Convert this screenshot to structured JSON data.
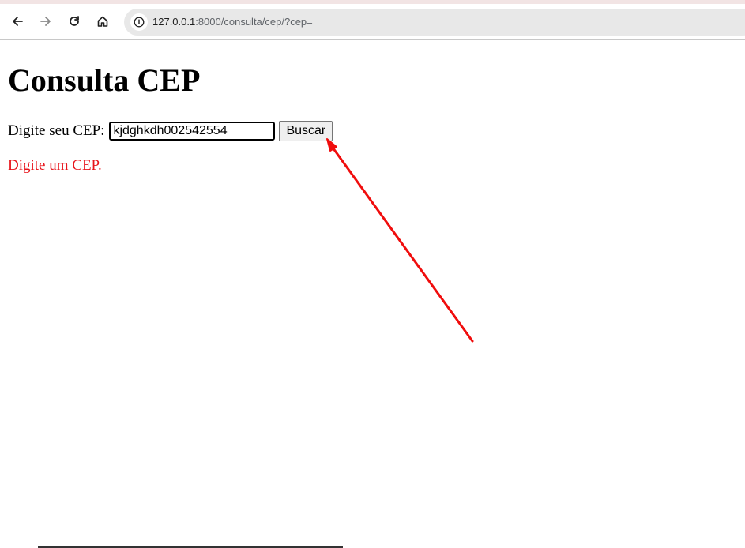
{
  "browser": {
    "url_host": "127.0.0.1",
    "url_rest": ":8000/consulta/cep/?cep=",
    "icons": [
      "back-arrow-icon",
      "forward-arrow-icon",
      "reload-icon",
      "home-icon",
      "site-info-icon"
    ]
  },
  "page": {
    "title": "Consulta CEP",
    "form": {
      "label": "Digite seu CEP:",
      "input_value": "kjdghkdh002542554",
      "button_label": "Buscar"
    },
    "error_message": "Digite um CEP.",
    "error_color": "#e8151c"
  },
  "annotation": {
    "arrow_color": "#f00d0d"
  }
}
